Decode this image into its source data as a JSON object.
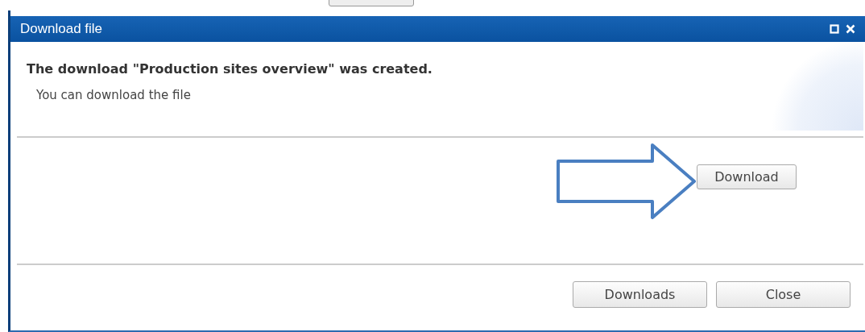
{
  "window": {
    "title": "Download file"
  },
  "message": {
    "heading": "The download \"Production sites overview\" was created.",
    "text": "You can download the file"
  },
  "action": {
    "button": "Download",
    "pointer_arrow": true
  },
  "buttons": [
    "Downloads",
    "Close"
  ]
}
